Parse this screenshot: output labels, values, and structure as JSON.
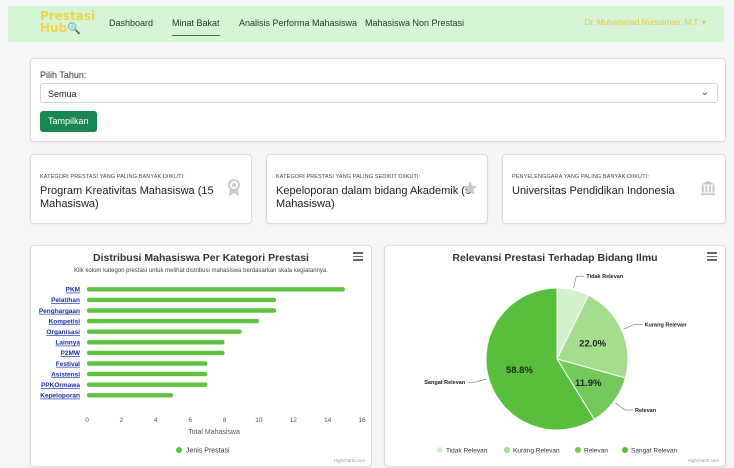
{
  "navbar": {
    "logo_line1": "Prestasi",
    "logo_line2": "Hub",
    "items": [
      {
        "label": "Dashboard"
      },
      {
        "label": "Minat Bakat"
      },
      {
        "label": "Analisis Performa Mahasiswa"
      },
      {
        "label": "Mahasiswa Non Prestasi"
      }
    ],
    "user": "Dr. Muhammad Nursalman, M.T.",
    "user_caret": "▾"
  },
  "filter": {
    "label": "Pilih Tahun:",
    "selected": "Semua",
    "button": "Tampilkan"
  },
  "stats": [
    {
      "caption": "KATEGORI PRESTASI YANG PALING BANYAK DIIKUTI:",
      "value": "Program Kreativitas Mahasiswa (15 Mahasiswa)",
      "icon": "award-icon"
    },
    {
      "caption": "KATEGORI PRESTASI YANG PALING SEDIKIT DIIKUTI:",
      "value": "Kepeloporan dalam bidang Akademik (5 Mahasiswa)",
      "icon": "star-icon"
    },
    {
      "caption": "PENYELENGGARA YANG PALING BANYAK DIIKUTI:",
      "value": "Universitas Pendidikan Indonesia",
      "icon": "institution-icon"
    }
  ],
  "colors": {
    "bar": "#5ec241",
    "accent": "#198754",
    "pie": [
      "#d4f1cd",
      "#a4dd8e",
      "#73c95c",
      "#58bf3c"
    ]
  },
  "credits": "Highcharts.com",
  "chart_data": [
    {
      "type": "bar",
      "title": "Distribusi Mahasiswa Per Kategori Prestasi",
      "subtitle": "Klik kolom kategori prestasi untuk melihat distribusi mahasiswa berdasarkan skala kegiatannya.",
      "categories": [
        "PKM",
        "Pelatihan",
        "Penghargaan",
        "Kompetisi",
        "Organisasi",
        "Lainnya",
        "P2MW",
        "Festival",
        "Asistensi",
        "PPKOrmawa",
        "Kepeloporan"
      ],
      "series": [
        {
          "name": "Jenis Prestasi",
          "values": [
            15,
            11,
            11,
            10,
            9,
            8,
            8,
            7,
            7,
            7,
            5
          ]
        }
      ],
      "xlabel": "Total Mahasiswa",
      "ticks": [
        "0",
        "2",
        "4",
        "6",
        "8",
        "10",
        "12",
        "14",
        "16"
      ],
      "xlim": [
        0,
        16
      ],
      "orientation": "horizontal",
      "grid": false,
      "legend": "bottom-center"
    },
    {
      "type": "pie",
      "title": "Relevansi Prestasi Terhadap Bidang Ilmu",
      "slices": [
        {
          "name": "Tidak Relevan",
          "value": 7.3,
          "label": ""
        },
        {
          "name": "Kurang Relevan",
          "value": 22.0,
          "label": "22.0%"
        },
        {
          "name": "Relevan",
          "value": 11.9,
          "label": "11.9%"
        },
        {
          "name": "Sangat Relevan",
          "value": 58.8,
          "label": "58.8%"
        }
      ],
      "legend": "bottom-center"
    }
  ]
}
